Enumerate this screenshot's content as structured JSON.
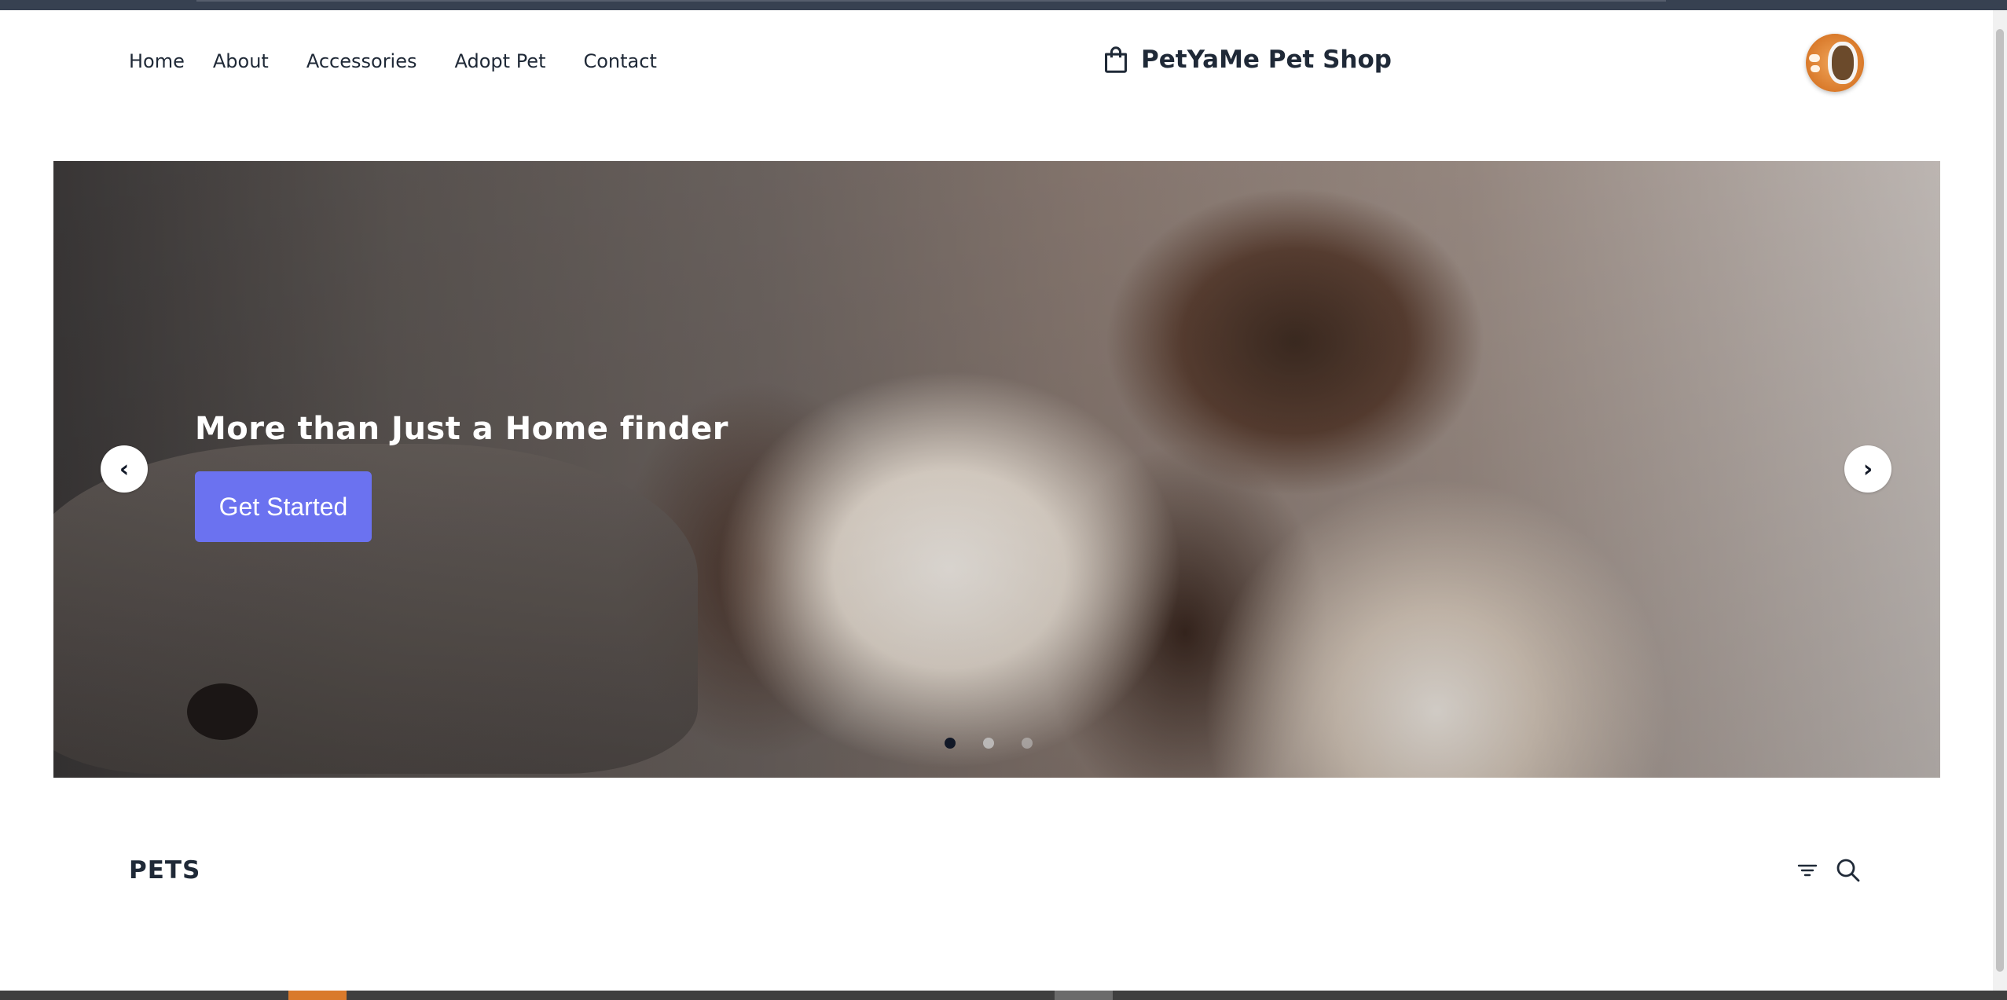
{
  "nav": {
    "items": [
      {
        "label": "Home"
      },
      {
        "label": "About"
      },
      {
        "label": "Accessories"
      },
      {
        "label": "Adopt Pet"
      },
      {
        "label": "Contact"
      }
    ]
  },
  "brand": {
    "name": "PetYaMe Pet Shop",
    "icon": "shopping-bag-icon"
  },
  "avatar": {
    "icon": "pet-food-bowl-avatar"
  },
  "hero": {
    "title": "More than Just a Home finder",
    "cta_label": "Get Started",
    "prev_label": "‹",
    "next_label": "›",
    "slide_count": 3,
    "active_slide": 1,
    "image_subject": "puppies"
  },
  "pets_section": {
    "title": "PETS",
    "filter_icon": "filter-icon",
    "search_icon": "search-icon"
  },
  "colors": {
    "primary_button": "#6b72f0",
    "text": "#1f2937",
    "topbar": "#374151",
    "background": "#ffffff"
  }
}
